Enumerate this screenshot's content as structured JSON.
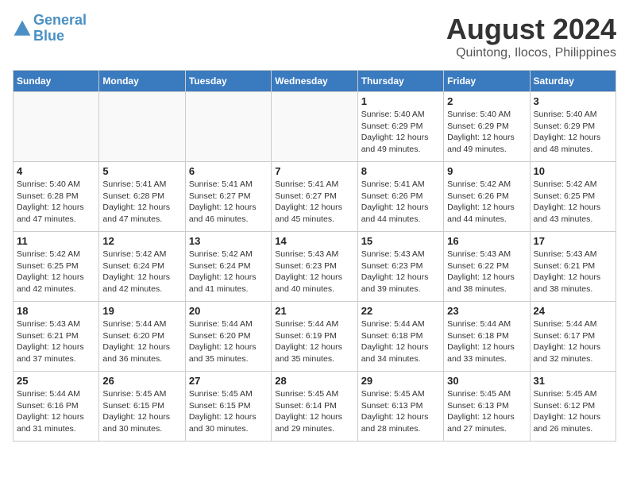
{
  "header": {
    "logo_general": "General",
    "logo_blue": "Blue",
    "month_title": "August 2024",
    "subtitle": "Quintong, Ilocos, Philippines"
  },
  "weekdays": [
    "Sunday",
    "Monday",
    "Tuesday",
    "Wednesday",
    "Thursday",
    "Friday",
    "Saturday"
  ],
  "weeks": [
    [
      {
        "day": "",
        "info": ""
      },
      {
        "day": "",
        "info": ""
      },
      {
        "day": "",
        "info": ""
      },
      {
        "day": "",
        "info": ""
      },
      {
        "day": "1",
        "info": "Sunrise: 5:40 AM\nSunset: 6:29 PM\nDaylight: 12 hours\nand 49 minutes."
      },
      {
        "day": "2",
        "info": "Sunrise: 5:40 AM\nSunset: 6:29 PM\nDaylight: 12 hours\nand 49 minutes."
      },
      {
        "day": "3",
        "info": "Sunrise: 5:40 AM\nSunset: 6:29 PM\nDaylight: 12 hours\nand 48 minutes."
      }
    ],
    [
      {
        "day": "4",
        "info": "Sunrise: 5:40 AM\nSunset: 6:28 PM\nDaylight: 12 hours\nand 47 minutes."
      },
      {
        "day": "5",
        "info": "Sunrise: 5:41 AM\nSunset: 6:28 PM\nDaylight: 12 hours\nand 47 minutes."
      },
      {
        "day": "6",
        "info": "Sunrise: 5:41 AM\nSunset: 6:27 PM\nDaylight: 12 hours\nand 46 minutes."
      },
      {
        "day": "7",
        "info": "Sunrise: 5:41 AM\nSunset: 6:27 PM\nDaylight: 12 hours\nand 45 minutes."
      },
      {
        "day": "8",
        "info": "Sunrise: 5:41 AM\nSunset: 6:26 PM\nDaylight: 12 hours\nand 44 minutes."
      },
      {
        "day": "9",
        "info": "Sunrise: 5:42 AM\nSunset: 6:26 PM\nDaylight: 12 hours\nand 44 minutes."
      },
      {
        "day": "10",
        "info": "Sunrise: 5:42 AM\nSunset: 6:25 PM\nDaylight: 12 hours\nand 43 minutes."
      }
    ],
    [
      {
        "day": "11",
        "info": "Sunrise: 5:42 AM\nSunset: 6:25 PM\nDaylight: 12 hours\nand 42 minutes."
      },
      {
        "day": "12",
        "info": "Sunrise: 5:42 AM\nSunset: 6:24 PM\nDaylight: 12 hours\nand 42 minutes."
      },
      {
        "day": "13",
        "info": "Sunrise: 5:42 AM\nSunset: 6:24 PM\nDaylight: 12 hours\nand 41 minutes."
      },
      {
        "day": "14",
        "info": "Sunrise: 5:43 AM\nSunset: 6:23 PM\nDaylight: 12 hours\nand 40 minutes."
      },
      {
        "day": "15",
        "info": "Sunrise: 5:43 AM\nSunset: 6:23 PM\nDaylight: 12 hours\nand 39 minutes."
      },
      {
        "day": "16",
        "info": "Sunrise: 5:43 AM\nSunset: 6:22 PM\nDaylight: 12 hours\nand 38 minutes."
      },
      {
        "day": "17",
        "info": "Sunrise: 5:43 AM\nSunset: 6:21 PM\nDaylight: 12 hours\nand 38 minutes."
      }
    ],
    [
      {
        "day": "18",
        "info": "Sunrise: 5:43 AM\nSunset: 6:21 PM\nDaylight: 12 hours\nand 37 minutes."
      },
      {
        "day": "19",
        "info": "Sunrise: 5:44 AM\nSunset: 6:20 PM\nDaylight: 12 hours\nand 36 minutes."
      },
      {
        "day": "20",
        "info": "Sunrise: 5:44 AM\nSunset: 6:20 PM\nDaylight: 12 hours\nand 35 minutes."
      },
      {
        "day": "21",
        "info": "Sunrise: 5:44 AM\nSunset: 6:19 PM\nDaylight: 12 hours\nand 35 minutes."
      },
      {
        "day": "22",
        "info": "Sunrise: 5:44 AM\nSunset: 6:18 PM\nDaylight: 12 hours\nand 34 minutes."
      },
      {
        "day": "23",
        "info": "Sunrise: 5:44 AM\nSunset: 6:18 PM\nDaylight: 12 hours\nand 33 minutes."
      },
      {
        "day": "24",
        "info": "Sunrise: 5:44 AM\nSunset: 6:17 PM\nDaylight: 12 hours\nand 32 minutes."
      }
    ],
    [
      {
        "day": "25",
        "info": "Sunrise: 5:44 AM\nSunset: 6:16 PM\nDaylight: 12 hours\nand 31 minutes."
      },
      {
        "day": "26",
        "info": "Sunrise: 5:45 AM\nSunset: 6:15 PM\nDaylight: 12 hours\nand 30 minutes."
      },
      {
        "day": "27",
        "info": "Sunrise: 5:45 AM\nSunset: 6:15 PM\nDaylight: 12 hours\nand 30 minutes."
      },
      {
        "day": "28",
        "info": "Sunrise: 5:45 AM\nSunset: 6:14 PM\nDaylight: 12 hours\nand 29 minutes."
      },
      {
        "day": "29",
        "info": "Sunrise: 5:45 AM\nSunset: 6:13 PM\nDaylight: 12 hours\nand 28 minutes."
      },
      {
        "day": "30",
        "info": "Sunrise: 5:45 AM\nSunset: 6:13 PM\nDaylight: 12 hours\nand 27 minutes."
      },
      {
        "day": "31",
        "info": "Sunrise: 5:45 AM\nSunset: 6:12 PM\nDaylight: 12 hours\nand 26 minutes."
      }
    ]
  ]
}
